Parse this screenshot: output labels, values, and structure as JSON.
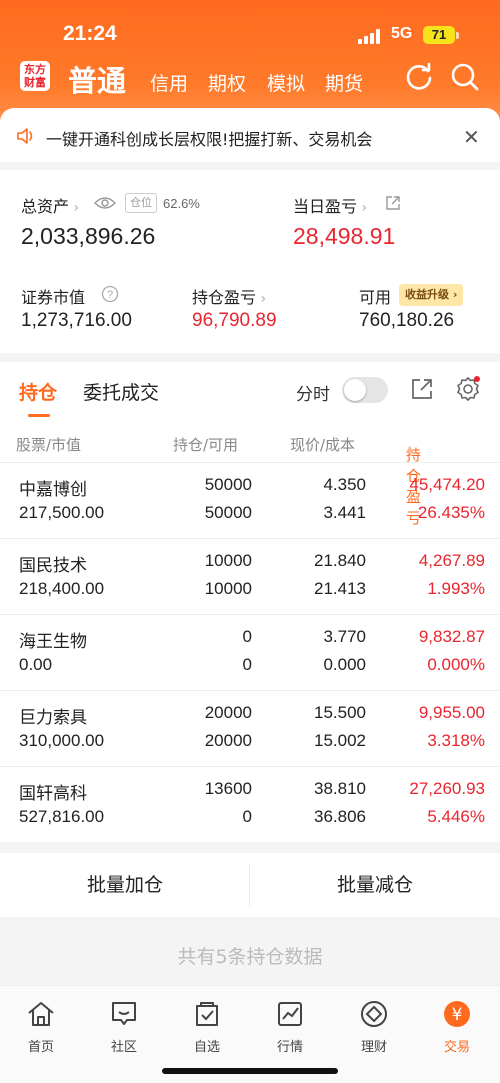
{
  "status": {
    "time": "21:24",
    "network": "5G",
    "battery": "71"
  },
  "brand": {
    "logo_line1": "东方",
    "logo_line2": "财富"
  },
  "nav": {
    "tabs": [
      "普通",
      "信用",
      "期权",
      "模拟",
      "期货"
    ]
  },
  "banner": {
    "text": "一键开通科创成长层权限!把握打新、交易机会"
  },
  "assets": {
    "total_label": "总资产",
    "position_tag": "仓位",
    "position_value": "62.6%",
    "total_value": "2,033,896.26",
    "daily_label": "当日盈亏",
    "daily_value": "28,498.91",
    "market_label": "证券市值",
    "market_value": "1,273,716.00",
    "pnl_label": "持仓盈亏",
    "pnl_value": "96,790.89",
    "avail_label": "可用",
    "avail_badge": "收益升级",
    "avail_value": "760,180.26"
  },
  "holdings": {
    "tab_active": "持仓",
    "tab_other": "委托成交",
    "toggle_label": "分时",
    "columns": {
      "stock": "股票/市值",
      "qty": "持仓/可用",
      "price": "现价/成本",
      "pnl": "持仓盈亏"
    },
    "rows": [
      {
        "name": "中嘉博创",
        "mv": "217,500.00",
        "qty": "50000",
        "avail": "50000",
        "price": "4.350",
        "cost": "3.441",
        "pnl": "45,474.20",
        "pct": "26.435%"
      },
      {
        "name": "国民技术",
        "mv": "218,400.00",
        "qty": "10000",
        "avail": "10000",
        "price": "21.840",
        "cost": "21.413",
        "pnl": "4,267.89",
        "pct": "1.993%"
      },
      {
        "name": "海王生物",
        "mv": "0.00",
        "qty": "0",
        "avail": "0",
        "price": "3.770",
        "cost": "0.000",
        "pnl": "9,832.87",
        "pct": "0.000%"
      },
      {
        "name": "巨力索具",
        "mv": "310,000.00",
        "qty": "20000",
        "avail": "20000",
        "price": "15.500",
        "cost": "15.002",
        "pnl": "9,955.00",
        "pct": "3.318%"
      },
      {
        "name": "国轩高科",
        "mv": "527,816.00",
        "qty": "13600",
        "avail": "0",
        "price": "38.810",
        "cost": "36.806",
        "pnl": "27,260.93",
        "pct": "5.446%"
      }
    ]
  },
  "batch": {
    "add": "批量加仓",
    "reduce": "批量减仓"
  },
  "summary": "共有5条持仓数据",
  "bottom_nav": [
    "首页",
    "社区",
    "自选",
    "行情",
    "理财",
    "交易"
  ],
  "colors": {
    "brand": "#ff6a1f",
    "profit": "#e8262f"
  }
}
